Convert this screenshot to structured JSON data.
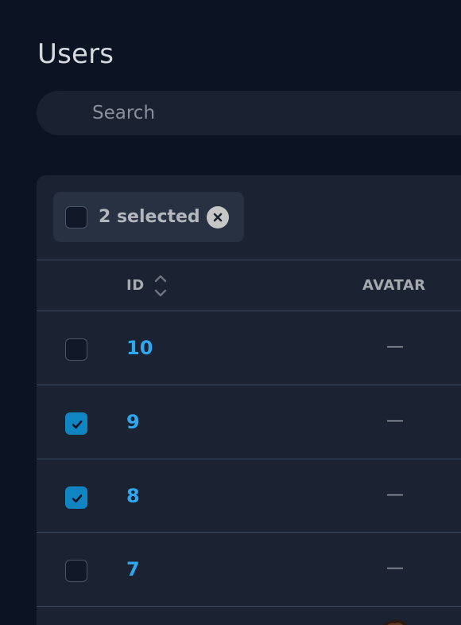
{
  "page": {
    "title": "Users"
  },
  "search": {
    "placeholder": "Search",
    "value": ""
  },
  "bulk": {
    "selected_label": "2 selected"
  },
  "table": {
    "columns": {
      "id": "ID",
      "avatar": "AVATAR"
    },
    "rows": [
      {
        "id": "10",
        "avatar": "—",
        "selected": false
      },
      {
        "id": "9",
        "avatar": "—",
        "selected": true
      },
      {
        "id": "8",
        "avatar": "—",
        "selected": true
      },
      {
        "id": "7",
        "avatar": "—",
        "selected": false
      }
    ]
  },
  "colors": {
    "background": "#0c1322",
    "panel": "#1b2231",
    "accent": "#0f85c4",
    "id_link": "#2ea8f0"
  },
  "icons": {
    "search": "search-icon",
    "clear": "close-circle-icon",
    "sort": "sort-icon",
    "check": "check-icon"
  }
}
